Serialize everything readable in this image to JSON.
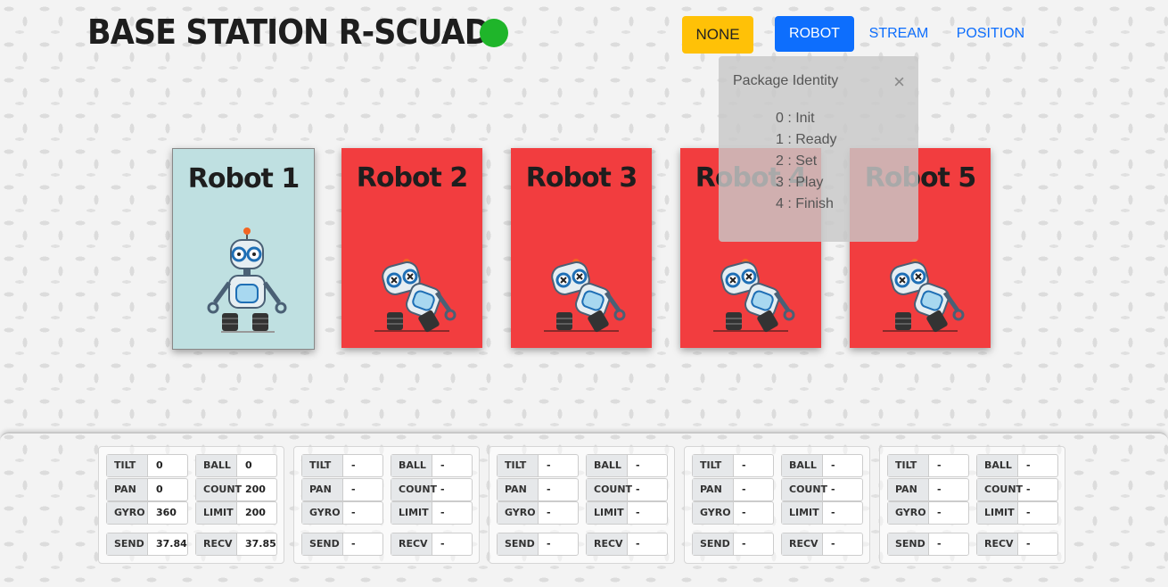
{
  "header": {
    "title": "BASE STATION R-SCUAD",
    "status_color": "#1fb52a"
  },
  "nav": {
    "none_label": "NONE",
    "robot_label": "ROBOT",
    "stream_label": "STREAM",
    "position_label": "POSITION",
    "active": "ROBOT"
  },
  "robots": [
    {
      "name": "Robot 1",
      "state": "active"
    },
    {
      "name": "Robot 2",
      "state": "inactive"
    },
    {
      "name": "Robot 3",
      "state": "inactive"
    },
    {
      "name": "Robot 4",
      "state": "inactive"
    },
    {
      "name": "Robot 5",
      "state": "inactive"
    }
  ],
  "popover": {
    "title": "Package Identity",
    "close_icon": "×",
    "items": [
      "0 : Init",
      "1 : Ready",
      "2 : Set",
      "3 : Play",
      "4 : Finish"
    ]
  },
  "labels": {
    "tilt": "TILT",
    "pan": "PAN",
    "gyro": "GYRO",
    "send": "SEND",
    "ball": "BALL",
    "count": "COUNT",
    "limit": "LIMIT",
    "recv": "RECV"
  },
  "panels": [
    {
      "tilt": "0",
      "pan": "0",
      "gyro": "360",
      "send": "37.84",
      "ball": "0",
      "count": "200",
      "limit": "200",
      "recv": "37.85"
    },
    {
      "tilt": "-",
      "pan": "-",
      "gyro": "-",
      "send": "-",
      "ball": "-",
      "count": "-",
      "limit": "-",
      "recv": "-"
    },
    {
      "tilt": "-",
      "pan": "-",
      "gyro": "-",
      "send": "-",
      "ball": "-",
      "count": "-",
      "limit": "-",
      "recv": "-"
    },
    {
      "tilt": "-",
      "pan": "-",
      "gyro": "-",
      "send": "-",
      "ball": "-",
      "count": "-",
      "limit": "-",
      "recv": "-"
    },
    {
      "tilt": "-",
      "pan": "-",
      "gyro": "-",
      "send": "-",
      "ball": "-",
      "count": "-",
      "limit": "-",
      "recv": "-"
    }
  ],
  "colors": {
    "active_card": "#bfe0e1",
    "inactive_card": "#f23d3f",
    "none_button": "#ffc107",
    "accent": "#0d6efd"
  }
}
